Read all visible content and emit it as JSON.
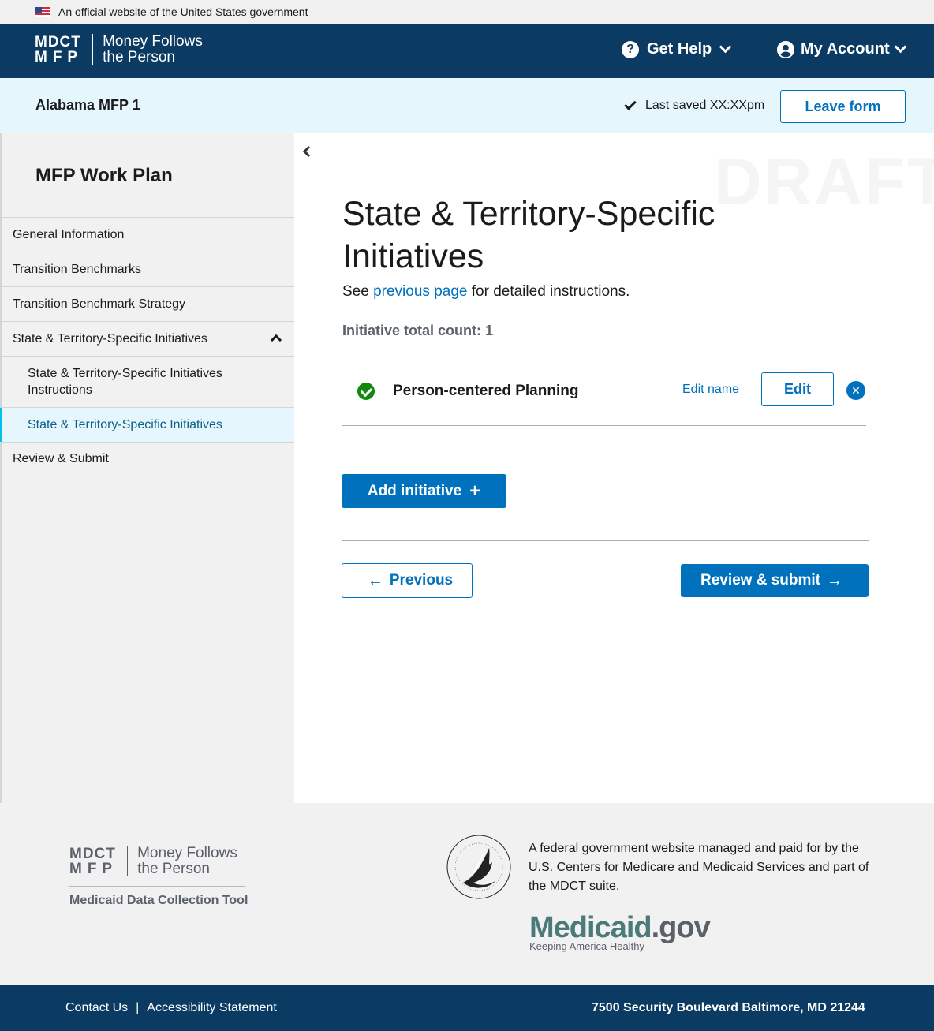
{
  "gov_banner": {
    "text": "An official website of the United States government"
  },
  "header": {
    "logo_abbr_line1": "MDCT",
    "logo_abbr_line2": "MFP",
    "logo_name_line1": "Money Follows",
    "logo_name_line2": "the Person",
    "get_help": "Get Help",
    "my_account": "My Account"
  },
  "subheader": {
    "state": "Alabama MFP 1",
    "saved": "Last saved XX:XXpm",
    "leave_form": "Leave form"
  },
  "sidebar": {
    "title": "MFP Work Plan",
    "items": [
      {
        "label": "General Information"
      },
      {
        "label": "Transition Benchmarks"
      },
      {
        "label": "Transition Benchmark Strategy"
      },
      {
        "label": "State & Territory-Specific Initiatives"
      },
      {
        "label": "State & Territory-Specific Initiatives Instructions"
      },
      {
        "label": "State & Territory-Specific Initiatives"
      },
      {
        "label": "Review & Submit"
      }
    ]
  },
  "main": {
    "watermark": "DRAFT",
    "title": "State & Territory-Specific Initiatives",
    "instr_prefix": "See ",
    "instr_link": "previous page",
    "instr_suffix": " for detailed instructions.",
    "count": "Initiative total count: 1",
    "initiatives": [
      {
        "name": "Person-centered Planning",
        "edit_name": "Edit name",
        "edit": "Edit"
      }
    ],
    "add_initiative": "Add initiative",
    "previous": "Previous",
    "review_submit": "Review & submit"
  },
  "footer": {
    "tool_name": "Medicaid Data Collection Tool",
    "statement": "A federal government website managed and paid for by the U.S. Centers for Medicare and Medicaid Services and part of the MDCT suite.",
    "medicaid_word": "Medicaid",
    "medicaid_gov": ".gov",
    "medicaid_tagline": "Keeping America Healthy",
    "contact_us": "Contact Us",
    "separator": "|",
    "accessibility": "Accessibility Statement",
    "address": "7500 Security Boulevard Baltimore, MD 21244"
  },
  "colors": {
    "header_bg": "#0b3b63",
    "primary": "#0071bc",
    "subheader_bg": "#e6f6fd",
    "success": "#12890e"
  }
}
